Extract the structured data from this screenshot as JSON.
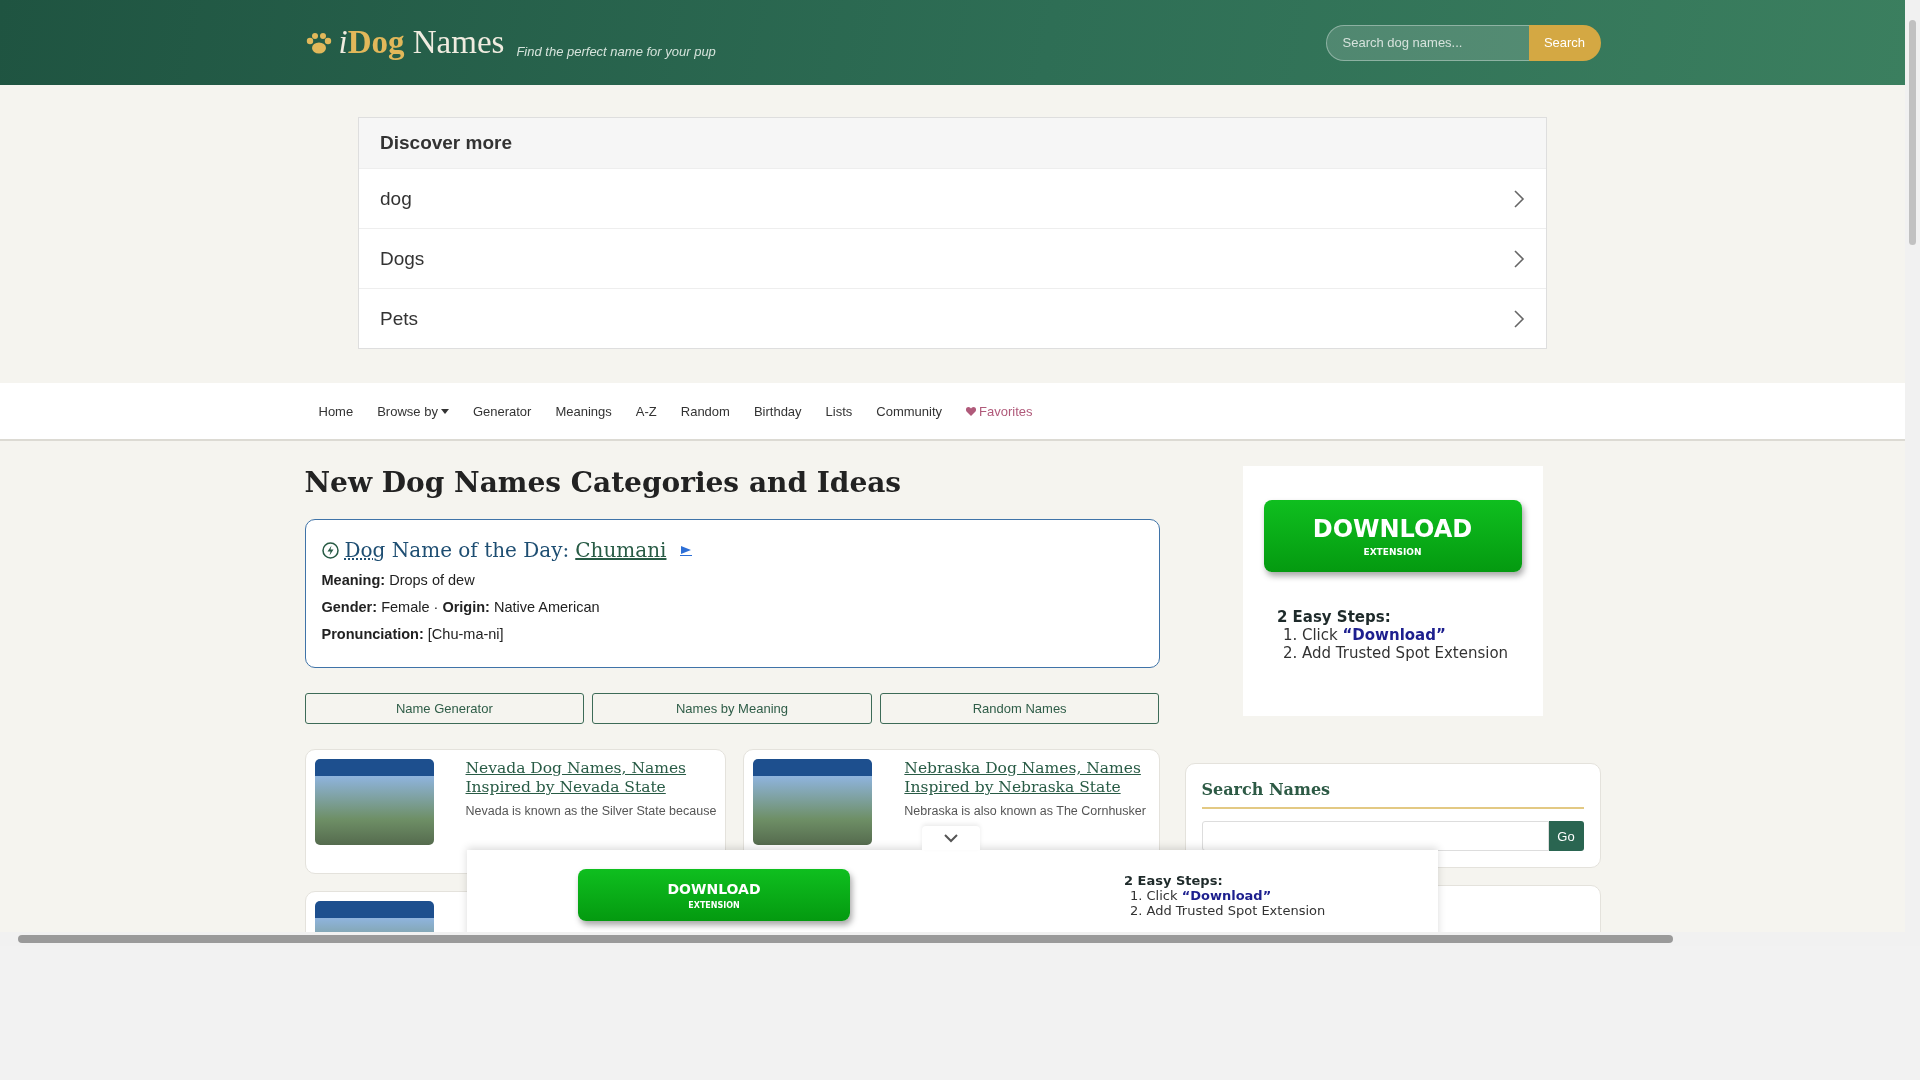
{
  "header": {
    "logo": {
      "prefix": "i",
      "brand": "Dog",
      "rest": "Names"
    },
    "tagline": "Find the perfect name for your pup",
    "search": {
      "placeholder": "Search dog names...",
      "button": "Search"
    }
  },
  "discover": {
    "title": "Discover more",
    "items": [
      "dog",
      "Dogs",
      "Pets"
    ]
  },
  "nav": [
    {
      "label": "Home",
      "kind": "link"
    },
    {
      "label": "Browse by",
      "kind": "dropdown"
    },
    {
      "label": "Generator",
      "kind": "link"
    },
    {
      "label": "Meanings",
      "kind": "link"
    },
    {
      "label": "A-Z",
      "kind": "link"
    },
    {
      "label": "Random",
      "kind": "link"
    },
    {
      "label": "Birthday",
      "kind": "link"
    },
    {
      "label": "Lists",
      "kind": "link"
    },
    {
      "label": "Community",
      "kind": "link"
    },
    {
      "label": "Favorites",
      "kind": "favorite"
    }
  ],
  "heading": "New Dog Names Categories and Ideas",
  "name_of_day": {
    "abbr": "Dog",
    "label": "Name of the Day:",
    "name": "Chumani",
    "separator": "·",
    "lines": [
      [
        {
          "label": "Meaning:",
          "value": "Drops of dew"
        }
      ],
      [
        {
          "label": "Gender:",
          "value": "Female"
        },
        {
          "label": "Origin:",
          "value": "Native American"
        }
      ],
      [
        {
          "label": "Pronunciation:",
          "value": "[Chu-ma-ni]"
        }
      ]
    ]
  },
  "quick_links": [
    "Name Generator",
    "Names by Meaning",
    "Random Names"
  ],
  "articles": [
    {
      "kind": "full",
      "title": "Nevada Dog Names, Names Inspired by Nevada State",
      "description": "Nevada is known as the Silver State because"
    },
    {
      "kind": "full",
      "title": "Nebraska Dog Names, Names Inspired by Nebraska State",
      "description": "Nebraska is also known as The Cornhusker"
    },
    {
      "kind": "image_only"
    }
  ],
  "ad": {
    "button_title": "DOWNLOAD",
    "button_sub": "EXTENSION",
    "steps_title": "2 Easy Steps:",
    "steps": [
      {
        "text": "1. Click",
        "highlight": "“Download”"
      },
      {
        "text": "2. Add Trusted Spot Extension"
      }
    ]
  },
  "search_names": {
    "title": "Search Names",
    "button": "Go"
  },
  "bottom_ad": {
    "button_title": "DOWNLOAD",
    "button_sub": "EXTENSION",
    "steps_title": "2 Easy Steps:",
    "steps": [
      {
        "text": "1. Click",
        "highlight": "“Download”"
      },
      {
        "text": "2. Add Trusted Spot Extension"
      }
    ]
  }
}
